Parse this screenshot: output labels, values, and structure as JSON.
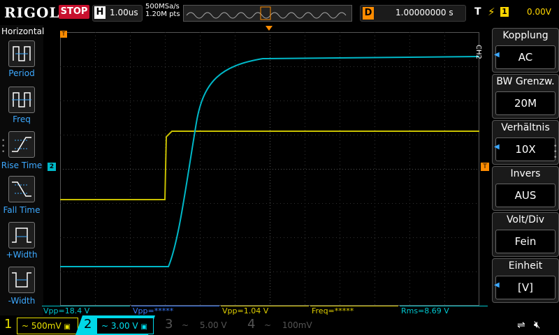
{
  "header": {
    "logo": "RIGOL",
    "run_state": "STOP",
    "horizontal_label": "H",
    "timebase": "1.00us",
    "sample_rate": "500MSa/s",
    "points": "1.20M pts",
    "delay_label": "D",
    "delay_value": "1.00000000 s",
    "trigger_label": "T",
    "trigger_source": "1",
    "trigger_level": "0.00V"
  },
  "left_menu": {
    "title": "Horizontal",
    "items": [
      {
        "label": "Period",
        "icon": "period-icon"
      },
      {
        "label": "Freq",
        "icon": "freq-icon"
      },
      {
        "label": "Rise Time",
        "icon": "rise-time-icon"
      },
      {
        "label": "Fall Time",
        "icon": "fall-time-icon"
      },
      {
        "label": "+Width",
        "icon": "plus-width-icon"
      },
      {
        "label": "-Width",
        "icon": "minus-width-icon"
      }
    ]
  },
  "right_menu": {
    "channel_tag": "CH2",
    "items": [
      {
        "title": "Kopplung",
        "value": "AC",
        "arrow": true
      },
      {
        "title": "BW Grenzw.",
        "value": "20M",
        "arrow": false
      },
      {
        "title": "Verhältnis",
        "value": "10X",
        "arrow": true
      },
      {
        "title": "Invers",
        "value": "AUS",
        "arrow": false
      },
      {
        "title": "Volt/Div",
        "value": "Fein",
        "arrow": false
      },
      {
        "title": "Einheit",
        "value": "[V]",
        "arrow": true
      }
    ]
  },
  "measurements": [
    {
      "text": "Vpp=18.4 V",
      "color": "#00c8d0"
    },
    {
      "text": "Vpp=*****",
      "color": "#3a7cff"
    },
    {
      "text": "Vpp=1.04 V",
      "color": "#e0d000"
    },
    {
      "text": "Freq=*****",
      "color": "#e0d000"
    },
    {
      "text": "Rms=8.69 V",
      "color": "#00c8d0"
    }
  ],
  "channels": [
    {
      "num": "1",
      "scale": "500mV",
      "color": "#e8e000",
      "active": true
    },
    {
      "num": "2",
      "scale": "3.00 V",
      "color": "#00e0f0",
      "active": true
    },
    {
      "num": "3",
      "scale": "5.00 V",
      "color": "#555555",
      "active": false
    },
    {
      "num": "4",
      "scale": "100mV",
      "color": "#555555",
      "active": false
    }
  ],
  "markers": {
    "ch1": "1",
    "ch2": "2"
  },
  "colors": {
    "ch1": "#c8c000",
    "ch2": "#00b8c8",
    "accent": "#ff8c00",
    "menu_blue": "#3da9ff"
  }
}
